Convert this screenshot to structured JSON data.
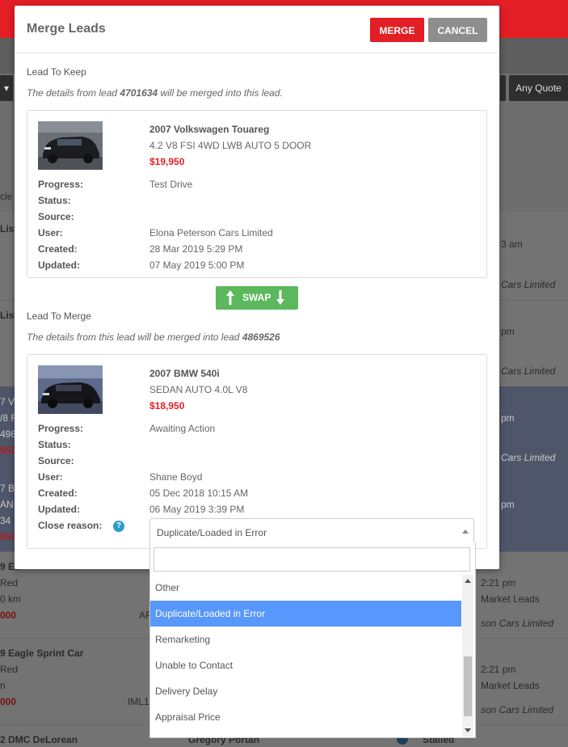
{
  "background": {
    "any_quote_label": "Any Quote",
    "left_fragments": [
      "cle",
      "List",
      "List",
      "7 V",
      "/8 F",
      "498",
      "950",
      "7 Bl",
      "AN",
      "34",
      "950",
      "9 Ea",
      "Red",
      "0 km",
      "000",
      "9 Eagle Sprint Car",
      "Red",
      "n",
      "000",
      "2 DMC DeLorean"
    ],
    "right_fragments": [
      "3 am",
      "Cars Limited",
      "pm",
      "Cars Limited",
      "pm",
      "Cars Limited",
      "pm",
      "2:21 pm",
      "Market Leads",
      "son Cars Limited",
      "2:21 pm",
      "Market Leads",
      "son Cars Limited",
      "Stalled"
    ],
    "mid_fragments": [
      "AP",
      "IML1",
      "Gregory Portan"
    ]
  },
  "modal": {
    "title": "Merge Leads",
    "merge_label": "MERGE",
    "cancel_label": "CANCEL",
    "keep": {
      "heading": "Lead To Keep",
      "desc_prefix": "The details from lead ",
      "desc_lead": "4701634",
      "desc_suffix": " will be merged into this lead.",
      "car_title": "2007 Volkswagen Touareg",
      "car_sub": "4.2 V8 FSI 4WD LWB AUTO 5 DOOR",
      "price": "$19,950",
      "fields": [
        {
          "label": "Progress:",
          "value": "Test Drive"
        },
        {
          "label": "Status:",
          "value": ""
        },
        {
          "label": "Source:",
          "value": ""
        },
        {
          "label": "User:",
          "value": "Elona Peterson Cars Limited"
        },
        {
          "label": "Created:",
          "value": "28 Mar 2019 5:29 PM"
        },
        {
          "label": "Updated:",
          "value": "07 May 2019 5:00 PM"
        }
      ]
    },
    "swap_label": "SWAP",
    "merge_lead": {
      "heading": "Lead To Merge",
      "desc_prefix": "The details from this lead will be merged into lead ",
      "desc_lead": "4869526",
      "desc_suffix": "",
      "car_title": "2007 BMW 540i",
      "car_sub": "SEDAN AUTO 4.0L V8",
      "price": "$18,950",
      "fields": [
        {
          "label": "Progress:",
          "value": "Awaiting Action"
        },
        {
          "label": "Status:",
          "value": ""
        },
        {
          "label": "Source:",
          "value": ""
        },
        {
          "label": "User:",
          "value": "Shane Boyd"
        },
        {
          "label": "Created:",
          "value": "05 Dec 2018 10:15 AM"
        },
        {
          "label": "Updated:",
          "value": "06 May 2019 3:39 PM"
        }
      ],
      "close_reason_label": "Close reason:",
      "close_reason_value": "Duplicate/Loaded in Error"
    }
  },
  "dropdown": {
    "search_value": "",
    "options": [
      "Other",
      "Duplicate/Loaded in Error",
      "Remarketing",
      "Unable to Contact",
      "Delivery Delay",
      "Appraisal Price"
    ],
    "selected_index": 1
  },
  "colors": {
    "brand_red": "#e31e24",
    "swap_green": "#5cb85c",
    "highlight_blue": "#5897fb",
    "help_blue": "#2b9bc9"
  }
}
